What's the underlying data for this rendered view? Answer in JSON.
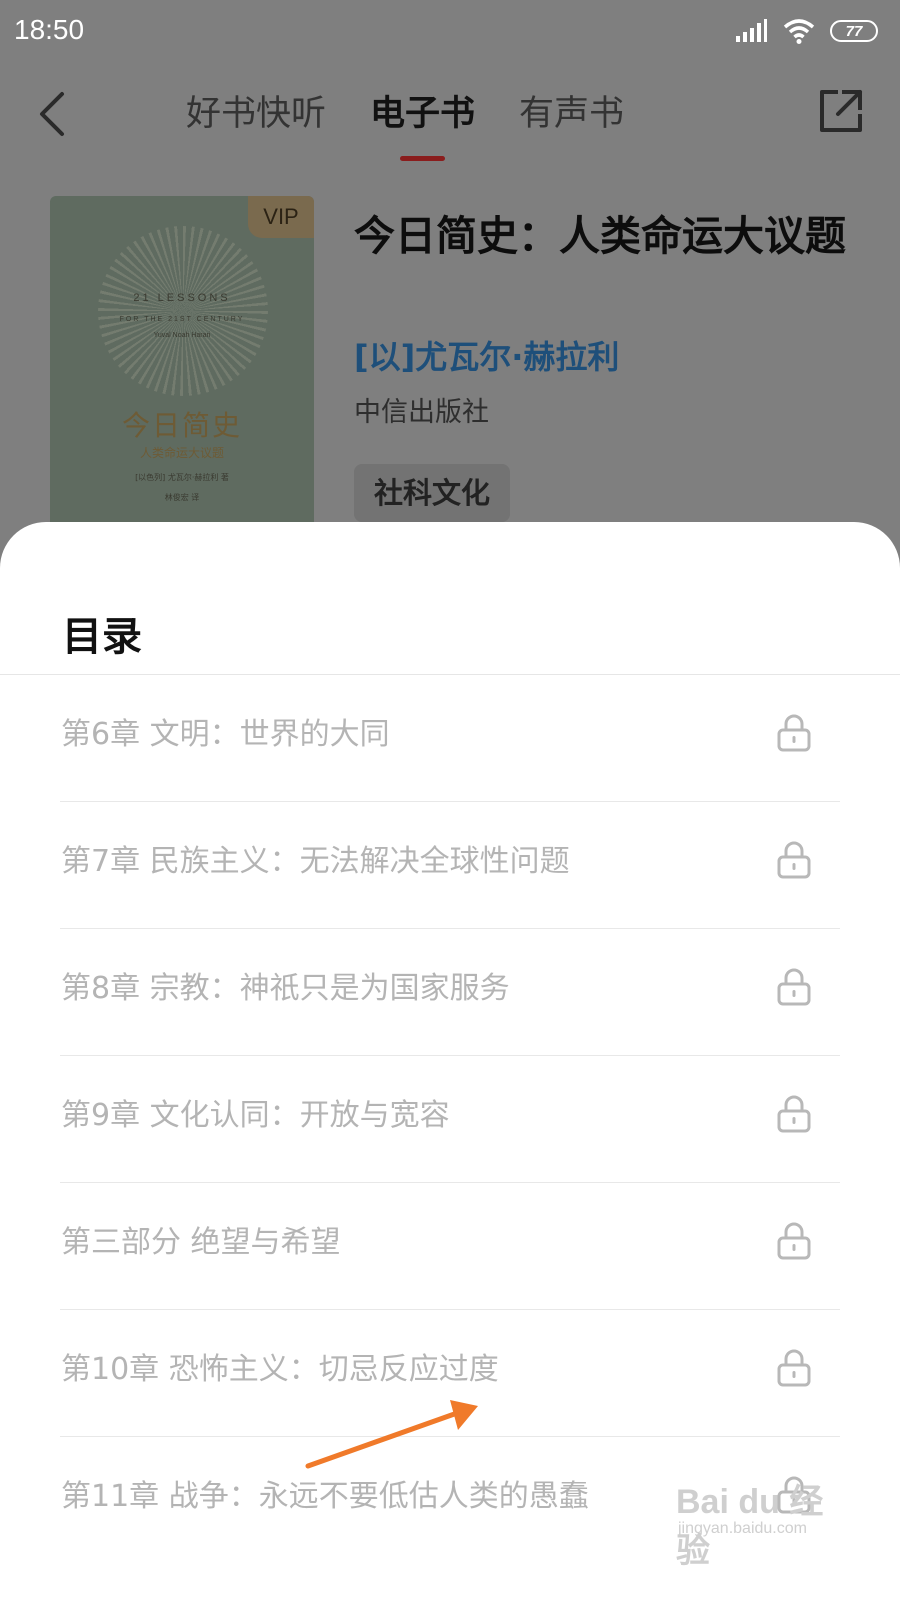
{
  "status_bar": {
    "time": "18:50",
    "battery": "77",
    "icons": [
      "signal-icon",
      "wifi-icon",
      "battery-icon"
    ]
  },
  "nav": {
    "back_icon": "chevron-left-icon",
    "share_icon": "share-icon",
    "tabs": [
      {
        "label": "好书快听",
        "active": false
      },
      {
        "label": "电子书",
        "active": true
      },
      {
        "label": "有声书",
        "active": false
      }
    ],
    "accent_color": "#8a1d1d"
  },
  "book": {
    "vip_badge": "VIP",
    "title": "今日简史：人类命运大议题",
    "author": "[以]尤瓦尔·赫拉利",
    "publisher": "中信出版社",
    "tag": "社科文化",
    "cover": {
      "english_title": "21 LESSONS",
      "english_subtitle": "FOR THE 21ST CENTURY",
      "english_author": "Yuval Noah Harari",
      "chinese_title": "今日简史",
      "chinese_subtitle": "人类命运大议题",
      "author_line": "[以色列] 尤瓦尔·赫拉利 著",
      "translator_line": "林俊宏 译"
    }
  },
  "toc": {
    "title": "目录",
    "lock_icon": "lock-icon",
    "items": [
      {
        "label": "第6章 文明：世界的大同"
      },
      {
        "label": "第7章 民族主义：无法解决全球性问题"
      },
      {
        "label": "第8章 宗教：神祇只是为国家服务"
      },
      {
        "label": "第9章 文化认同：开放与宽容"
      },
      {
        "label": "第三部分 绝望与希望"
      },
      {
        "label": "第10章 恐怖主义：切忌反应过度"
      },
      {
        "label": "第11章 战争：永远不要低估人类的愚蠢"
      }
    ]
  },
  "annotation": {
    "arrow_color": "#f07a2a"
  },
  "watermark": {
    "logo": "Bai du 经验",
    "url": "jingyan.baidu.com"
  }
}
